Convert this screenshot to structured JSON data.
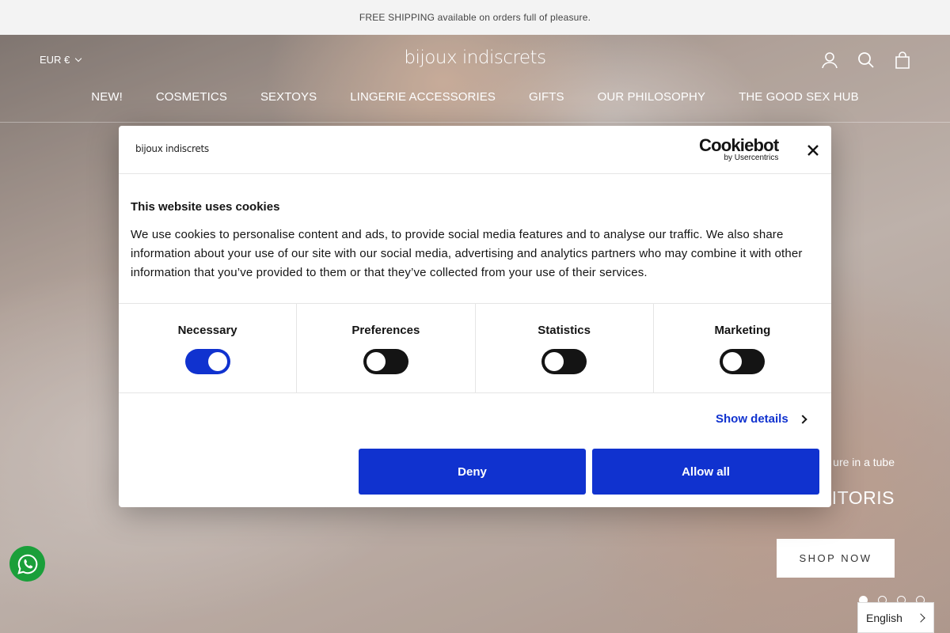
{
  "announcement": "FREE SHIPPING available on orders full of pleasure.",
  "header": {
    "currency": "EUR €",
    "logo": "bijoux indiscrets",
    "nav": [
      "NEW!",
      "COSMETICS",
      "SEXTOYS",
      "LINGERIE ACCESSORIES",
      "GIFTS",
      "OUR PHILOSOPHY",
      "THE GOOD SEX HUB"
    ],
    "icons": [
      "account-icon",
      "search-icon",
      "bag-icon"
    ]
  },
  "hero": {
    "subtitle": "ure in a tube",
    "title": "CLITORIS",
    "cta": "SHOP NOW",
    "slides": 4,
    "active_slide": 1
  },
  "cookie": {
    "logo": "bijoux indiscrets",
    "provider": "Cookiebot",
    "provider_sub": "by Usercentrics",
    "title": "This website uses cookies",
    "text": "We use cookies to personalise content and ads, to provide social media features and to analyse our traffic. We also share information about your use of our site with our social media, advertising and analytics partners who may combine it with other information that you’ve provided to them or that they’ve collected from your use of their services.",
    "categories": [
      {
        "label": "Necessary",
        "checked": true
      },
      {
        "label": "Preferences",
        "checked": false
      },
      {
        "label": "Statistics",
        "checked": false
      },
      {
        "label": "Marketing",
        "checked": false
      }
    ],
    "show_details": "Show details",
    "deny": "Deny",
    "allow_all": "Allow all"
  },
  "language": "English",
  "colors": {
    "accent": "#1032cf",
    "whatsapp": "#1a9f3a"
  }
}
